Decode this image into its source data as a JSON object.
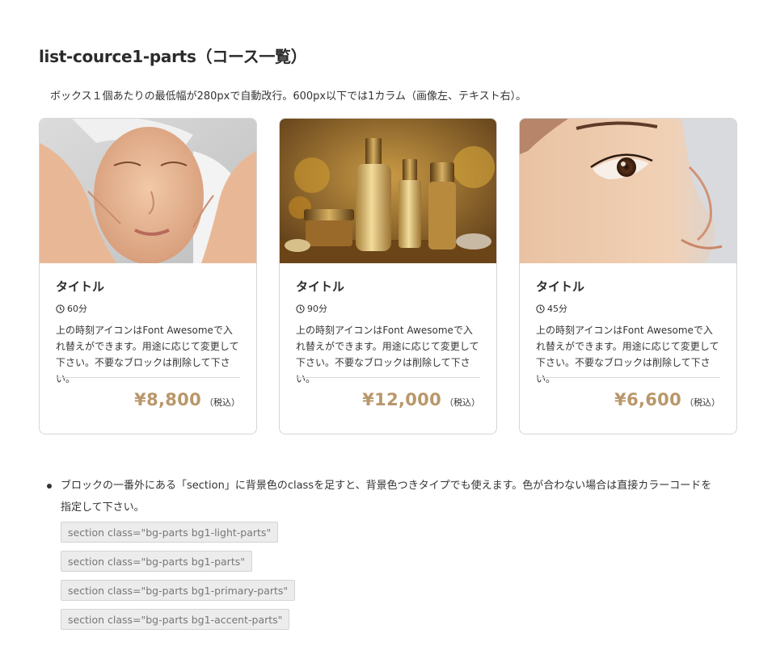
{
  "heading": "list-cource1-parts（コース一覧）",
  "lead": "ボックス１個あたりの最低幅が280pxで自動改行。600px以下では1カラム（画像左、テキスト右）。",
  "cards": [
    {
      "image_subject": "facial massage",
      "title": "タイトル",
      "time": "60分",
      "description": "上の時刻アイコンはFont Awesomeで入れ替えができます。用途に応じて変更して下さい。不要なブロックは削除して下さい。",
      "price": "¥8,800",
      "tax": "（税込）"
    },
    {
      "image_subject": "gold cosmetic bottles",
      "title": "タイトル",
      "time": "90分",
      "description": "上の時刻アイコンはFont Awesomeで入れ替えができます。用途に応じて変更して下さい。不要なブロックは削除して下さい。",
      "price": "¥12,000",
      "tax": "（税込）"
    },
    {
      "image_subject": "close-up eye profile",
      "title": "タイトル",
      "time": "45分",
      "description": "上の時刻アイコンはFont Awesomeで入れ替えができます。用途に応じて変更して下さい。不要なブロックは削除して下さい。",
      "price": "¥6,600",
      "tax": "（税込）"
    }
  ],
  "note": {
    "text": "ブロックの一番外にある「section」に背景色のclassを足すと、背景色つきタイプでも使えます。色が合わない場合は直接カラーコードを指定して下さい。",
    "codes": [
      "section class=\"bg-parts bg1-light-parts\"",
      "section class=\"bg-parts bg1-parts\"",
      "section class=\"bg-parts bg1-primary-parts\"",
      "section class=\"bg-parts bg1-accent-parts\""
    ]
  },
  "colors": {
    "price": "#b9976a",
    "text": "#333333",
    "border": "#d6d6d6",
    "code_bg": "#ececec"
  },
  "icons": {
    "time": "clock-icon",
    "bullet": "list-bullet"
  }
}
